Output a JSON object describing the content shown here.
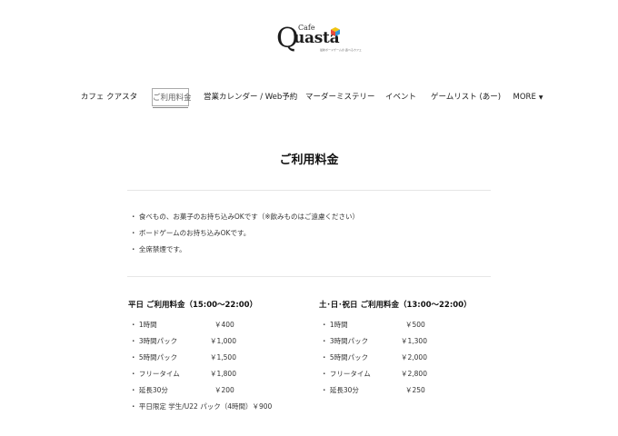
{
  "logo": {
    "cafe": "Cafe",
    "q": "Q",
    "rest": "uasta",
    "tagline": "最新ボードゲームの 遊べるカフェ",
    "colors": [
      "#e74c3c",
      "#f1c40f",
      "#3498db",
      "#2ecc71"
    ]
  },
  "nav": {
    "items": [
      {
        "label": "カフェ クアスタ"
      },
      {
        "label": "ご利用料金"
      },
      {
        "label": "営業カレンダー / Web予約"
      },
      {
        "label": "マーダーミステリー"
      },
      {
        "label": "イベント"
      },
      {
        "label": "ゲームリスト (あー)"
      },
      {
        "label": "MORE"
      }
    ],
    "more_caret": "▼"
  },
  "page_title": "ご利用料金",
  "notes": [
    "・ 食べもの、お菓子のお持ち込みOKです（※飲みものはご遠慮ください）",
    "・ ボードゲームのお持ち込みOKです。",
    "・ 全席禁煙です。"
  ],
  "weekday": {
    "title": "平日 ご利用料金（15:00〜22:00）",
    "rows": [
      {
        "label": "・ 1時間",
        "price": "￥400"
      },
      {
        "label": "・ 3時間パック",
        "price": "￥1,000"
      },
      {
        "label": "・ 5時間パック",
        "price": "￥1,500"
      },
      {
        "label": "・ フリータイム",
        "price": "￥1,800"
      },
      {
        "label": "・ 延長30分",
        "price": "￥200"
      }
    ],
    "extra": "・ 平日限定 学生/U22 パック（4時間）￥900"
  },
  "weekend": {
    "title": "土･日･祝日 ご利用料金（13:00〜22:00）",
    "rows": [
      {
        "label": "・ 1時間",
        "price": "￥500"
      },
      {
        "label": "・ 3時間パック",
        "price": "￥1,300"
      },
      {
        "label": "・ 5時間パック",
        "price": "￥2,000"
      },
      {
        "label": "・ フリータイム",
        "price": "￥2,800"
      },
      {
        "label": "・ 延長30分",
        "price": "￥250"
      }
    ]
  }
}
